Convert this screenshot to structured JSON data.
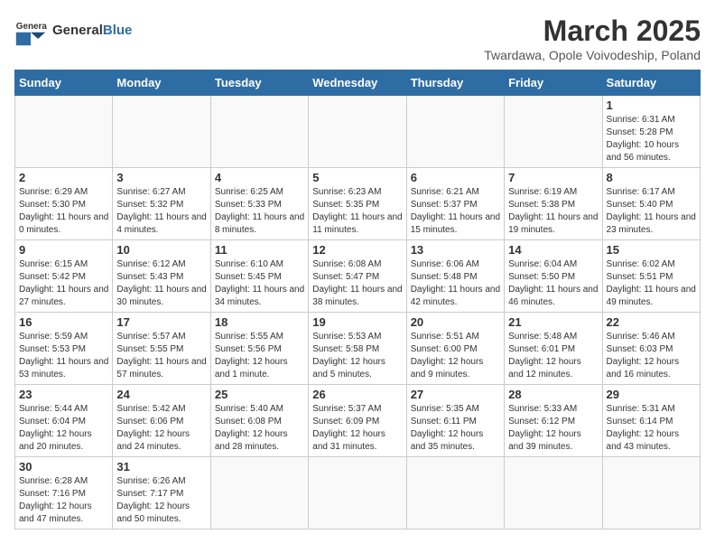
{
  "header": {
    "logo_general": "General",
    "logo_blue": "Blue",
    "month_title": "March 2025",
    "subtitle": "Twardawa, Opole Voivodeship, Poland"
  },
  "days_of_week": [
    "Sunday",
    "Monday",
    "Tuesday",
    "Wednesday",
    "Thursday",
    "Friday",
    "Saturday"
  ],
  "weeks": [
    [
      {
        "day": "",
        "info": ""
      },
      {
        "day": "",
        "info": ""
      },
      {
        "day": "",
        "info": ""
      },
      {
        "day": "",
        "info": ""
      },
      {
        "day": "",
        "info": ""
      },
      {
        "day": "",
        "info": ""
      },
      {
        "day": "1",
        "info": "Sunrise: 6:31 AM\nSunset: 5:28 PM\nDaylight: 10 hours and 56 minutes."
      }
    ],
    [
      {
        "day": "2",
        "info": "Sunrise: 6:29 AM\nSunset: 5:30 PM\nDaylight: 11 hours and 0 minutes."
      },
      {
        "day": "3",
        "info": "Sunrise: 6:27 AM\nSunset: 5:32 PM\nDaylight: 11 hours and 4 minutes."
      },
      {
        "day": "4",
        "info": "Sunrise: 6:25 AM\nSunset: 5:33 PM\nDaylight: 11 hours and 8 minutes."
      },
      {
        "day": "5",
        "info": "Sunrise: 6:23 AM\nSunset: 5:35 PM\nDaylight: 11 hours and 11 minutes."
      },
      {
        "day": "6",
        "info": "Sunrise: 6:21 AM\nSunset: 5:37 PM\nDaylight: 11 hours and 15 minutes."
      },
      {
        "day": "7",
        "info": "Sunrise: 6:19 AM\nSunset: 5:38 PM\nDaylight: 11 hours and 19 minutes."
      },
      {
        "day": "8",
        "info": "Sunrise: 6:17 AM\nSunset: 5:40 PM\nDaylight: 11 hours and 23 minutes."
      }
    ],
    [
      {
        "day": "9",
        "info": "Sunrise: 6:15 AM\nSunset: 5:42 PM\nDaylight: 11 hours and 27 minutes."
      },
      {
        "day": "10",
        "info": "Sunrise: 6:12 AM\nSunset: 5:43 PM\nDaylight: 11 hours and 30 minutes."
      },
      {
        "day": "11",
        "info": "Sunrise: 6:10 AM\nSunset: 5:45 PM\nDaylight: 11 hours and 34 minutes."
      },
      {
        "day": "12",
        "info": "Sunrise: 6:08 AM\nSunset: 5:47 PM\nDaylight: 11 hours and 38 minutes."
      },
      {
        "day": "13",
        "info": "Sunrise: 6:06 AM\nSunset: 5:48 PM\nDaylight: 11 hours and 42 minutes."
      },
      {
        "day": "14",
        "info": "Sunrise: 6:04 AM\nSunset: 5:50 PM\nDaylight: 11 hours and 46 minutes."
      },
      {
        "day": "15",
        "info": "Sunrise: 6:02 AM\nSunset: 5:51 PM\nDaylight: 11 hours and 49 minutes."
      }
    ],
    [
      {
        "day": "16",
        "info": "Sunrise: 5:59 AM\nSunset: 5:53 PM\nDaylight: 11 hours and 53 minutes."
      },
      {
        "day": "17",
        "info": "Sunrise: 5:57 AM\nSunset: 5:55 PM\nDaylight: 11 hours and 57 minutes."
      },
      {
        "day": "18",
        "info": "Sunrise: 5:55 AM\nSunset: 5:56 PM\nDaylight: 12 hours and 1 minute."
      },
      {
        "day": "19",
        "info": "Sunrise: 5:53 AM\nSunset: 5:58 PM\nDaylight: 12 hours and 5 minutes."
      },
      {
        "day": "20",
        "info": "Sunrise: 5:51 AM\nSunset: 6:00 PM\nDaylight: 12 hours and 9 minutes."
      },
      {
        "day": "21",
        "info": "Sunrise: 5:48 AM\nSunset: 6:01 PM\nDaylight: 12 hours and 12 minutes."
      },
      {
        "day": "22",
        "info": "Sunrise: 5:46 AM\nSunset: 6:03 PM\nDaylight: 12 hours and 16 minutes."
      }
    ],
    [
      {
        "day": "23",
        "info": "Sunrise: 5:44 AM\nSunset: 6:04 PM\nDaylight: 12 hours and 20 minutes."
      },
      {
        "day": "24",
        "info": "Sunrise: 5:42 AM\nSunset: 6:06 PM\nDaylight: 12 hours and 24 minutes."
      },
      {
        "day": "25",
        "info": "Sunrise: 5:40 AM\nSunset: 6:08 PM\nDaylight: 12 hours and 28 minutes."
      },
      {
        "day": "26",
        "info": "Sunrise: 5:37 AM\nSunset: 6:09 PM\nDaylight: 12 hours and 31 minutes."
      },
      {
        "day": "27",
        "info": "Sunrise: 5:35 AM\nSunset: 6:11 PM\nDaylight: 12 hours and 35 minutes."
      },
      {
        "day": "28",
        "info": "Sunrise: 5:33 AM\nSunset: 6:12 PM\nDaylight: 12 hours and 39 minutes."
      },
      {
        "day": "29",
        "info": "Sunrise: 5:31 AM\nSunset: 6:14 PM\nDaylight: 12 hours and 43 minutes."
      }
    ],
    [
      {
        "day": "30",
        "info": "Sunrise: 6:28 AM\nSunset: 7:16 PM\nDaylight: 12 hours and 47 minutes."
      },
      {
        "day": "31",
        "info": "Sunrise: 6:26 AM\nSunset: 7:17 PM\nDaylight: 12 hours and 50 minutes."
      },
      {
        "day": "",
        "info": ""
      },
      {
        "day": "",
        "info": ""
      },
      {
        "day": "",
        "info": ""
      },
      {
        "day": "",
        "info": ""
      },
      {
        "day": "",
        "info": ""
      }
    ]
  ]
}
